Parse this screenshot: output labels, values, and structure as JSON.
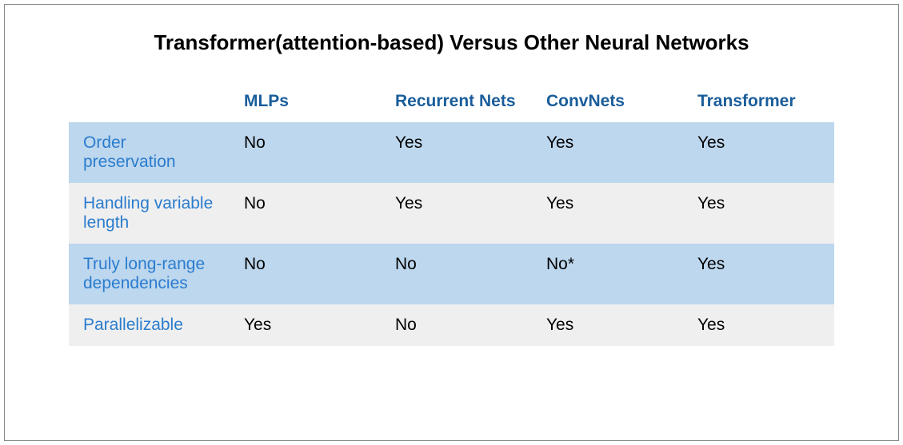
{
  "chart_data": {
    "type": "table",
    "title": "Transformer(attention-based) Versus Other Neural Networks",
    "columns": [
      "MLPs",
      "Recurrent Nets",
      "ConvNets",
      "Transformer"
    ],
    "rows": [
      {
        "label": "Order preservation",
        "values": [
          "No",
          "Yes",
          "Yes",
          "Yes"
        ]
      },
      {
        "label": "Handling variable length",
        "values": [
          "No",
          "Yes",
          "Yes",
          "Yes"
        ]
      },
      {
        "label": "Truly long-range dependencies",
        "values": [
          "No",
          "No",
          "No*",
          "Yes"
        ]
      },
      {
        "label": "Parallelizable",
        "values": [
          "Yes",
          "No",
          "Yes",
          "Yes"
        ]
      }
    ]
  }
}
